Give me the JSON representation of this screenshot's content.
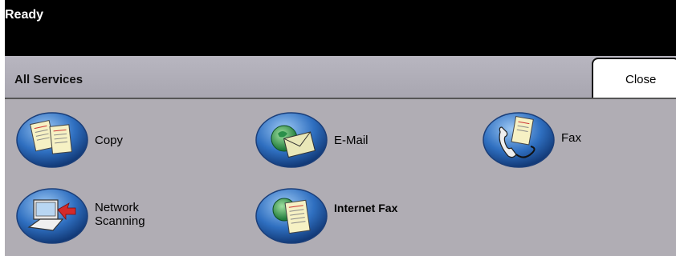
{
  "status": {
    "text": "Ready"
  },
  "header": {
    "title": "All Services",
    "close_label": "Close"
  },
  "services": [
    {
      "label": "Copy",
      "icon": "copy-icon"
    },
    {
      "label": "E-Mail",
      "icon": "email-icon"
    },
    {
      "label": "Fax",
      "icon": "fax-icon"
    },
    {
      "label_line1": "Network",
      "label_line2": "Scanning",
      "icon": "network-scanning-icon"
    },
    {
      "label": "Internet Fax",
      "icon": "internet-fax-icon"
    }
  ],
  "colors": {
    "status_bar": "#000000",
    "header_bg": "#b0aeb8",
    "main_bg": "#b0adb4",
    "icon_blue": "#2f6fc0"
  }
}
